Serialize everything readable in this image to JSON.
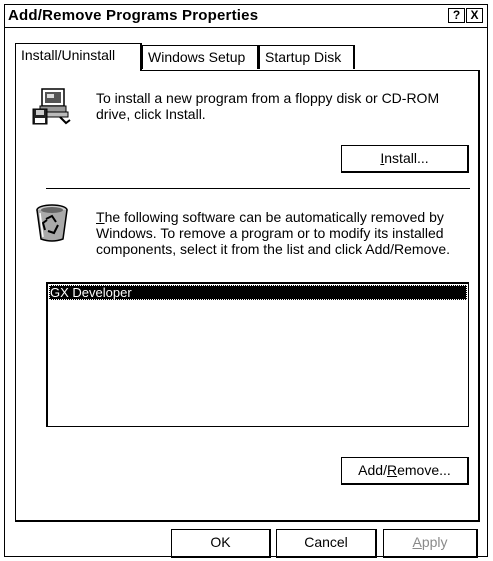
{
  "window": {
    "title": "Add/Remove Programs Properties",
    "help_label": "?",
    "close_label": "X"
  },
  "tabs": [
    {
      "label": "Install/Uninstall",
      "active": true
    },
    {
      "label": "Windows Setup",
      "active": false
    },
    {
      "label": "Startup Disk",
      "active": false
    }
  ],
  "install_section": {
    "icon": "floppy-computer-icon",
    "description": "To install a new program from a floppy disk or CD-ROM drive, click Install.",
    "button_prefix": "",
    "button_mnemonic": "I",
    "button_suffix": "nstall..."
  },
  "remove_section": {
    "icon": "recycle-bin-icon",
    "description_mnemonic": "T",
    "description_rest": "he following software can be automatically removed by Windows. To remove a program or to modify its installed components, select it from the list and click Add/Remove.",
    "list_items": [
      {
        "label": "GX Developer",
        "selected": true
      }
    ],
    "button_prefix": "Add/",
    "button_mnemonic": "R",
    "button_suffix": "emove..."
  },
  "footer": {
    "ok_label": "OK",
    "cancel_label": "Cancel",
    "apply_mnemonic": "A",
    "apply_rest": "pply"
  }
}
